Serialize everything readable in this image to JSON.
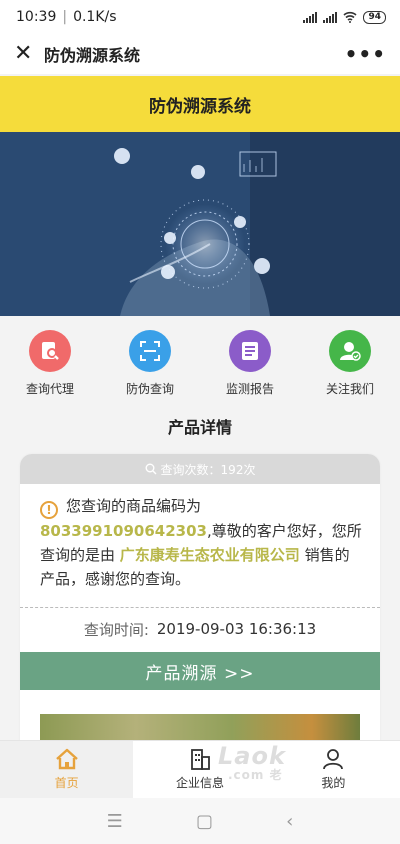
{
  "statusbar": {
    "time": "10:39",
    "speed": "0.1K/s",
    "battery": "94"
  },
  "nav": {
    "title": "防伪溯源系统"
  },
  "header": {
    "title": "防伪溯源系统"
  },
  "quick": [
    {
      "label": "查询代理",
      "color": "#f06a6a",
      "icon": "agent-search-icon"
    },
    {
      "label": "防伪查询",
      "color": "#3aa0e8",
      "icon": "scan-icon"
    },
    {
      "label": "监测报告",
      "color": "#8b5cc9",
      "icon": "report-icon"
    },
    {
      "label": "关注我们",
      "color": "#45b649",
      "icon": "follow-user-icon"
    }
  ],
  "section_title": "产品详情",
  "card": {
    "count_text": "查询次数：192次",
    "msg_prefix": "您查询的商品编码为",
    "code": "8033991090642303",
    "msg_mid": ",尊敬的客户您好，您所查询的是由",
    "company": "广东康寿生态农业有限公司",
    "msg_suffix": "销售的产品，感谢您的查询。",
    "time_label": "查询时间:",
    "time_value": "2019-09-03 16:36:13",
    "trace_button": "产品溯源 >>"
  },
  "tabs": [
    {
      "label": "首页",
      "icon": "home-icon",
      "active": true
    },
    {
      "label": "企业信息",
      "icon": "building-icon",
      "active": false
    },
    {
      "label": "我的",
      "icon": "user-icon",
      "active": false
    }
  ],
  "watermark": {
    "text": "Laok",
    "sub": ".com 老"
  },
  "colors": {
    "accent": "#f5dc3b",
    "trace": "#6aa384",
    "highlight": "#b8b74a",
    "tab_active": "#e6a23c"
  }
}
